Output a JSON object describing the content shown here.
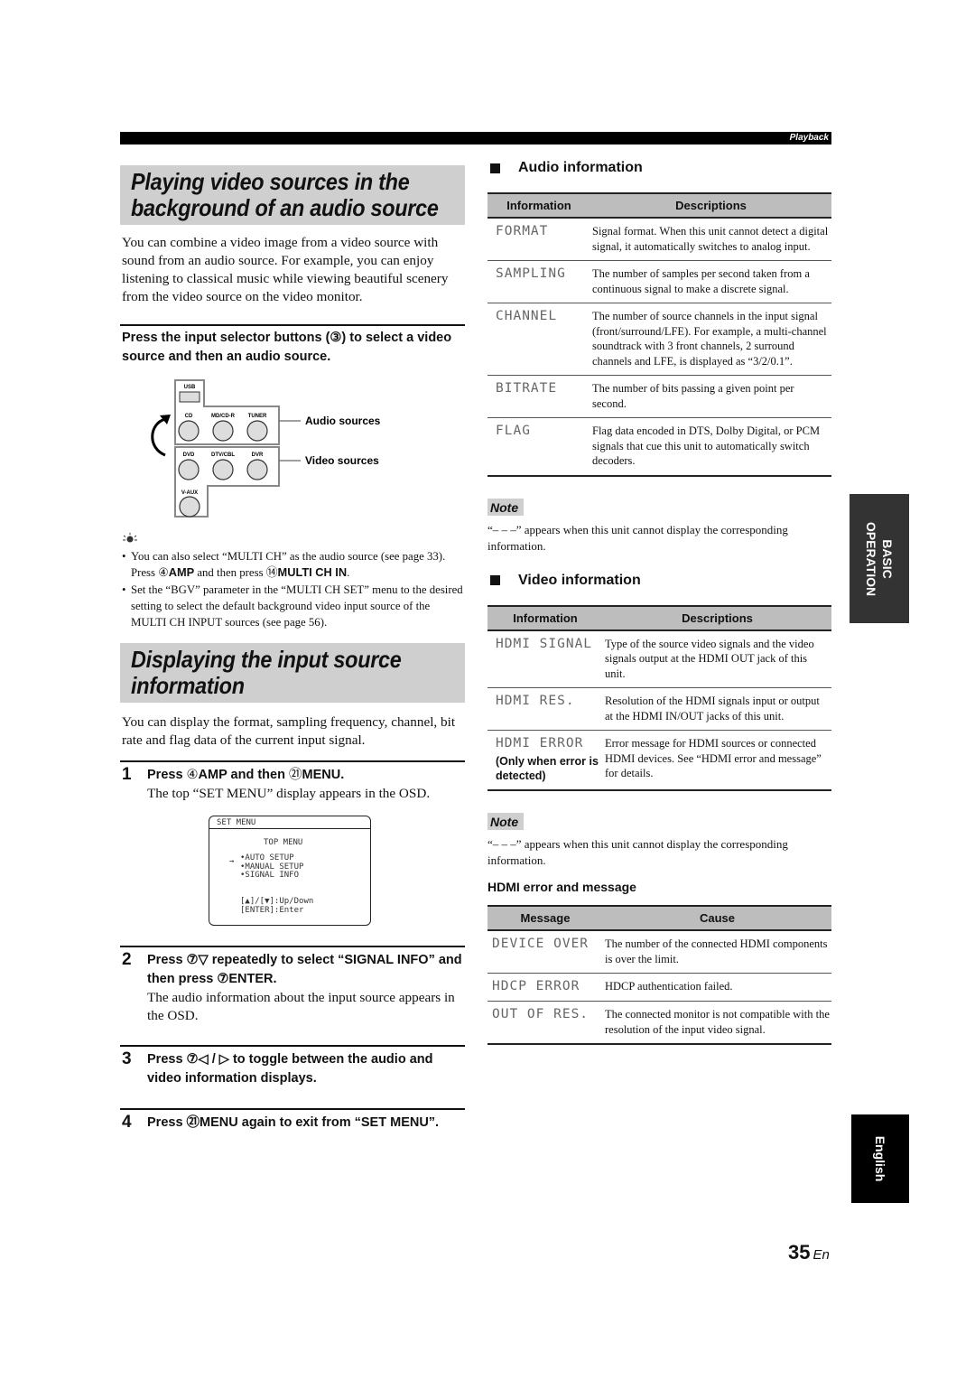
{
  "header": {
    "section_label": "Playback"
  },
  "left": {
    "section1": {
      "title_line1": "Playing video sources in the",
      "title_line2": "background of an audio source",
      "intro": "You can combine a video image from a video source with sound from an audio source. For example, you can enjoy listening to classical music while viewing beautiful scenery from the video source on the video monitor.",
      "instruction": "Press the input selector buttons (③) to select a video source and then an audio source.",
      "diagram": {
        "usb_label": "USB",
        "audio_buttons": [
          "CD",
          "MD/CD-R",
          "TUNER"
        ],
        "video_buttons": [
          "DVD",
          "DTV/CBL",
          "DVR"
        ],
        "extra_button": "V-AUX",
        "audio_sources_label": "Audio sources",
        "video_sources_label": "Video sources"
      },
      "tip_icon": "lightbulb-hint-icon",
      "tips": [
        {
          "pre": "You can also select “MULTI CH” as the audio source (see page 33). Press ",
          "c1": "④",
          "b1": "AMP",
          "mid": " and then press ",
          "c2": "⑭",
          "b2": "MULTI CH IN",
          "post": "."
        },
        {
          "text": "Set the “BGV” parameter in the “MULTI CH SET” menu to the desired setting to select the default background video input source of the MULTI CH INPUT sources (see page 56)."
        }
      ]
    },
    "section2": {
      "title_line1": "Displaying the input source",
      "title_line2": "information",
      "intro": "You can display the format, sampling frequency, channel, bit rate and flag data of the current input signal.",
      "steps": [
        {
          "num": "1",
          "title_pre": "Press ",
          "c1": "④",
          "b1": "AMP",
          "title_mid": " and then ",
          "c2": "㉑",
          "b2": "MENU",
          "title_post": ".",
          "body": "The top “SET MENU” display appears in the OSD."
        },
        {
          "num": "2",
          "title": "Press ⑦▽ repeatedly to select “SIGNAL INFO” and then press ⑦ENTER.",
          "body": "The audio information about the input source appears in the OSD."
        },
        {
          "num": "3",
          "title": "Press ⑦◁ / ▷ to toggle between the audio and video information displays."
        },
        {
          "num": "4",
          "title": "Press ㉑MENU again to exit from “SET MENU”."
        }
      ],
      "osd": {
        "title": "SET MENU",
        "heading": "TOP MENU",
        "cursor": "→",
        "items": [
          "•AUTO SETUP",
          "•MANUAL SETUP",
          "•SIGNAL INFO"
        ],
        "key_hint1": "[▲]/[▼]:Up/Down",
        "key_hint2": "[ENTER]:Enter"
      }
    }
  },
  "right": {
    "audio": {
      "heading": "Audio information",
      "col1": "Information",
      "col2": "Descriptions",
      "rows": [
        {
          "name": "FORMAT",
          "desc": "Signal format. When this unit cannot detect a digital signal, it automatically switches to analog input."
        },
        {
          "name": "SAMPLING",
          "desc": "The number of samples per second taken from a continuous signal to make a discrete signal."
        },
        {
          "name": "CHANNEL",
          "desc": "The number of source channels in the input signal (front/surround/LFE). For example, a multi-channel soundtrack with 3 front channels, 2 surround channels and LFE, is displayed as “3/2/0.1”."
        },
        {
          "name": "BITRATE",
          "desc": "The number of bits passing a given point per second."
        },
        {
          "name": "FLAG",
          "desc": "Flag data encoded in DTS, Dolby Digital, or PCM signals that cue this unit to automatically switch decoders."
        }
      ],
      "note_label": "Note",
      "note_text": "“– – –” appears when this unit cannot display the corresponding information."
    },
    "video": {
      "heading": "Video information",
      "col1": "Information",
      "col2": "Descriptions",
      "rows": [
        {
          "name": "HDMI SIGNAL",
          "desc": "Type of the source video signals and the video signals output at the HDMI OUT jack of this unit."
        },
        {
          "name": "HDMI RES.",
          "desc": "Resolution of the HDMI signals input or output at the HDMI IN/OUT jacks of this unit."
        },
        {
          "name": "HDMI ERROR",
          "sub": "(Only when error is detected)",
          "desc": "Error message for HDMI sources or connected HDMI devices. See “HDMI error and message” for details."
        }
      ],
      "note_label": "Note",
      "note_text": "“– – –” appears when this unit cannot display the corresponding information."
    },
    "hdmi_errors": {
      "heading": "HDMI error and message",
      "col1": "Message",
      "col2": "Cause",
      "rows": [
        {
          "name": "DEVICE OVER",
          "desc": "The number of the connected HDMI components is over the limit."
        },
        {
          "name": "HDCP ERROR",
          "desc": "HDCP authentication failed."
        },
        {
          "name": "OUT OF RES.",
          "desc": "The connected monitor is not compatible with the resolution of the input video signal."
        }
      ]
    }
  },
  "side_tabs": {
    "basic_line1": "BASIC",
    "basic_line2": "OPERATION",
    "language": "English"
  },
  "footer": {
    "page_number": "35",
    "page_suffix": "En"
  }
}
